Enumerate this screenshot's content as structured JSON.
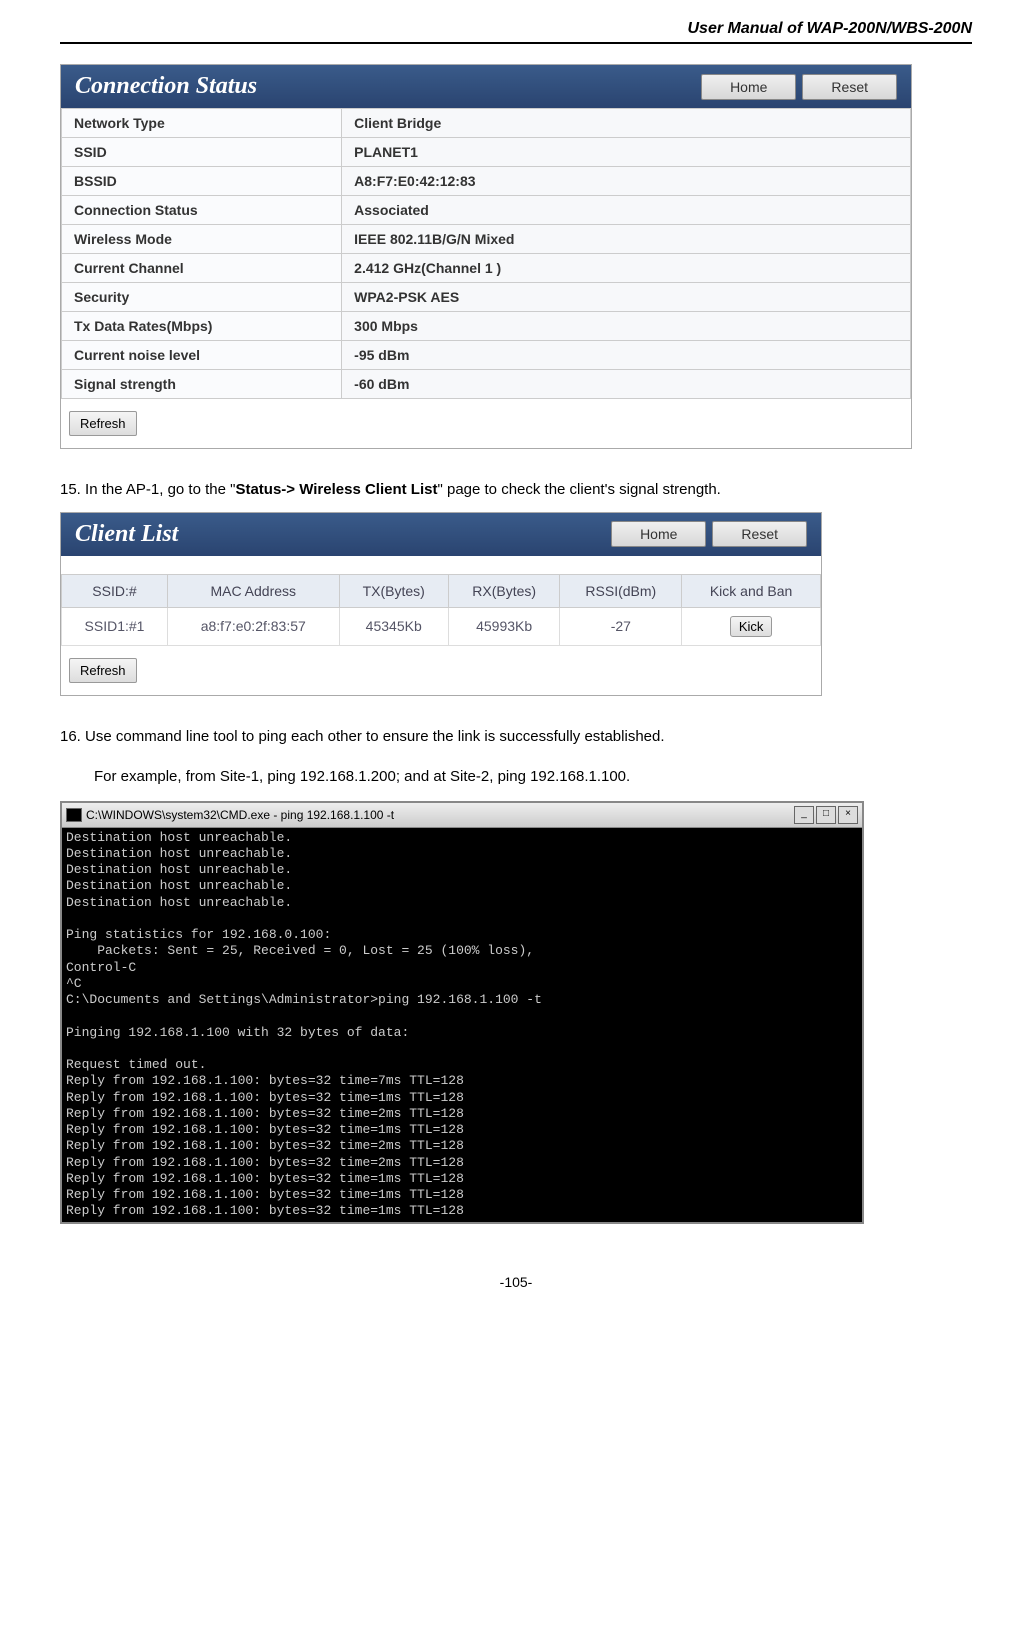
{
  "doc_header": "User Manual of WAP-200N/WBS-200N",
  "page_number": "-105-",
  "connection_status": {
    "title": "Connection Status",
    "home_btn": "Home",
    "reset_btn": "Reset",
    "refresh_btn": "Refresh",
    "rows": [
      {
        "label": "Network Type",
        "value": "Client Bridge"
      },
      {
        "label": "SSID",
        "value": "PLANET1"
      },
      {
        "label": "BSSID",
        "value": "A8:F7:E0:42:12:83"
      },
      {
        "label": "Connection Status",
        "value": "Associated"
      },
      {
        "label": "Wireless Mode",
        "value": "IEEE 802.11B/G/N Mixed"
      },
      {
        "label": "Current Channel",
        "value": "2.412 GHz(Channel 1 )"
      },
      {
        "label": "Security",
        "value": "WPA2-PSK AES"
      },
      {
        "label": "Tx Data Rates(Mbps)",
        "value": "300 Mbps"
      },
      {
        "label": "Current noise level",
        "value": "-95 dBm"
      },
      {
        "label": "Signal strength",
        "value": "-60 dBm"
      }
    ]
  },
  "step15": {
    "num": "15.",
    "prefix": "In the AP-1, go to the \"",
    "bold": "Status-> Wireless Client List",
    "suffix": "\" page to check the client's signal strength."
  },
  "client_list": {
    "title": "Client List",
    "home_btn": "Home",
    "reset_btn": "Reset",
    "refresh_btn": "Refresh",
    "headers": [
      "SSID:#",
      "MAC Address",
      "TX(Bytes)",
      "RX(Bytes)",
      "RSSI(dBm)",
      "Kick and Ban"
    ],
    "row": {
      "ssid": "SSID1:#1",
      "mac": "a8:f7:e0:2f:83:57",
      "tx": "45345Kb",
      "rx": "45993Kb",
      "rssi": "-27",
      "kick_btn": "Kick"
    }
  },
  "step16": {
    "num": "16.",
    "line1": "Use command line tool to ping each other to ensure the link is successfully established.",
    "line2": "For example, from Site-1, ping 192.168.1.200; and at Site-2, ping 192.168.1.100."
  },
  "cmd": {
    "title": "C:\\WINDOWS\\system32\\CMD.exe - ping 192.168.1.100 -t",
    "body": "Destination host unreachable.\nDestination host unreachable.\nDestination host unreachable.\nDestination host unreachable.\nDestination host unreachable.\n\nPing statistics for 192.168.0.100:\n    Packets: Sent = 25, Received = 0, Lost = 25 (100% loss),\nControl-C\n^C\nC:\\Documents and Settings\\Administrator>ping 192.168.1.100 -t\n\nPinging 192.168.1.100 with 32 bytes of data:\n\nRequest timed out.\nReply from 192.168.1.100: bytes=32 time=7ms TTL=128\nReply from 192.168.1.100: bytes=32 time=1ms TTL=128\nReply from 192.168.1.100: bytes=32 time=2ms TTL=128\nReply from 192.168.1.100: bytes=32 time=1ms TTL=128\nReply from 192.168.1.100: bytes=32 time=2ms TTL=128\nReply from 192.168.1.100: bytes=32 time=2ms TTL=128\nReply from 192.168.1.100: bytes=32 time=1ms TTL=128\nReply from 192.168.1.100: bytes=32 time=1ms TTL=128\nReply from 192.168.1.100: bytes=32 time=1ms TTL=128"
  }
}
